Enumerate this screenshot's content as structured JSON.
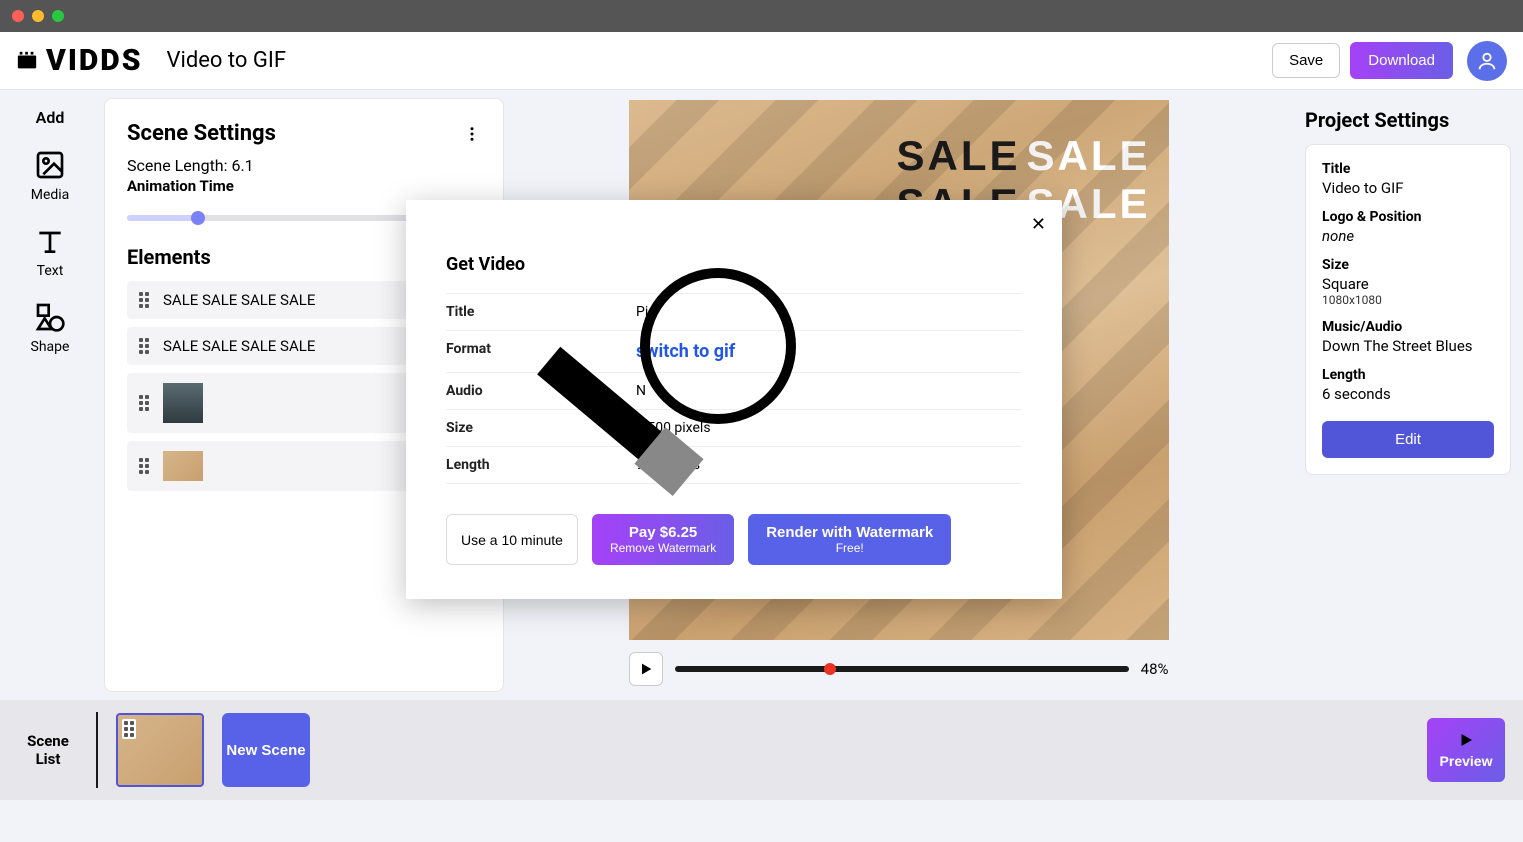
{
  "app": {
    "name": "VIDDS",
    "pageTitle": "Video to GIF"
  },
  "topbar": {
    "save": "Save",
    "download": "Download"
  },
  "sidebar": {
    "add": "Add",
    "media": "Media",
    "text": "Text",
    "shape": "Shape"
  },
  "scene": {
    "settingsTitle": "Scene Settings",
    "lengthLabel": "Scene Length: 6.1",
    "animTimeLabel": "Animation Time",
    "elementsTitle": "Elements",
    "elements": [
      "SALE SALE SALE SALE",
      "SALE SALE SALE SALE"
    ]
  },
  "canvas": {
    "saleWord": "SALE",
    "playPercent": "48%"
  },
  "projectSettings": {
    "heading": "Project Settings",
    "titleLabel": "Title",
    "titleValue": "Video to GIF",
    "logoLabel": "Logo & Position",
    "logoValue": "none",
    "sizeLabel": "Size",
    "sizeValue": "Square",
    "sizeSub": "1080x1080",
    "musicLabel": "Music/Audio",
    "musicValue": "Down The Street Blues",
    "lengthLabel": "Length",
    "lengthValue": "6 seconds",
    "editBtn": "Edit"
  },
  "bottom": {
    "sceneListLabel": "Scene List",
    "newScene": "New Scene",
    "preview": "Preview"
  },
  "modal": {
    "title": "Get Video",
    "rows": {
      "titleLabel": "Title",
      "titleValue": "Pi",
      "formatLabel": "Format",
      "formatValue": "switch to gif",
      "audioLabel": "Audio",
      "audioValue": "N",
      "sizeLabel": "Size",
      "sizeValue": "5      500 pixels",
      "lengthLabel": "Length",
      "lengthValue": "9 seconds"
    },
    "couponBtn": "Use a 10 minute",
    "payLine1": "Pay $6.25",
    "payLine2": "Remove Watermark",
    "renderLine1": "Render with Watermark",
    "renderLine2": "Free!"
  }
}
